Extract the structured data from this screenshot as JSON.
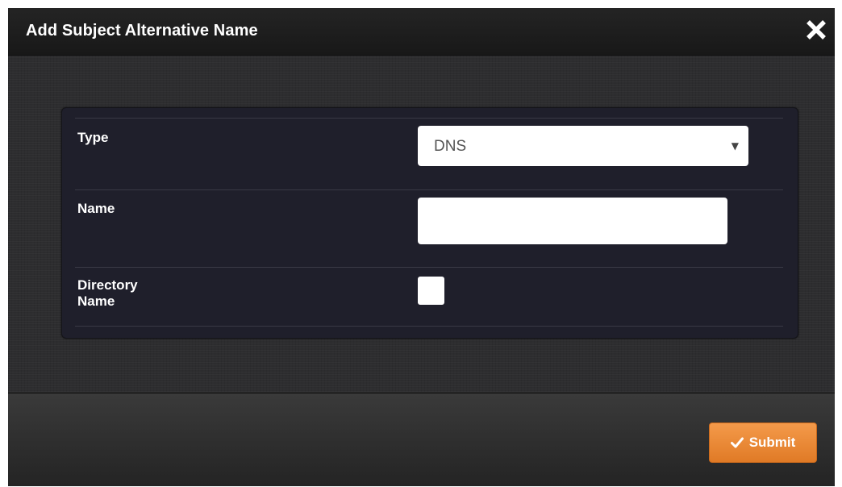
{
  "dialog": {
    "title": "Add Subject Alternative Name",
    "close_icon": "close-icon"
  },
  "form": {
    "type": {
      "label": "Type",
      "selected_value": "DNS",
      "dropdown_icon": "caret-down-icon",
      "caret_glyph": "▼"
    },
    "name": {
      "label": "Name",
      "value": "",
      "placeholder": ""
    },
    "directory_name": {
      "label_line1": "Directory",
      "label_line2": "Name",
      "checked": false
    }
  },
  "footer": {
    "submit_label": "Submit",
    "submit_icon": "check-icon",
    "submit_color": "#ec8a38"
  },
  "colors": {
    "header_bg": "#1e1e1e",
    "body_bg": "#2d2d2f",
    "panel_bg": "#1f1f2b",
    "text": "#ffffff"
  }
}
